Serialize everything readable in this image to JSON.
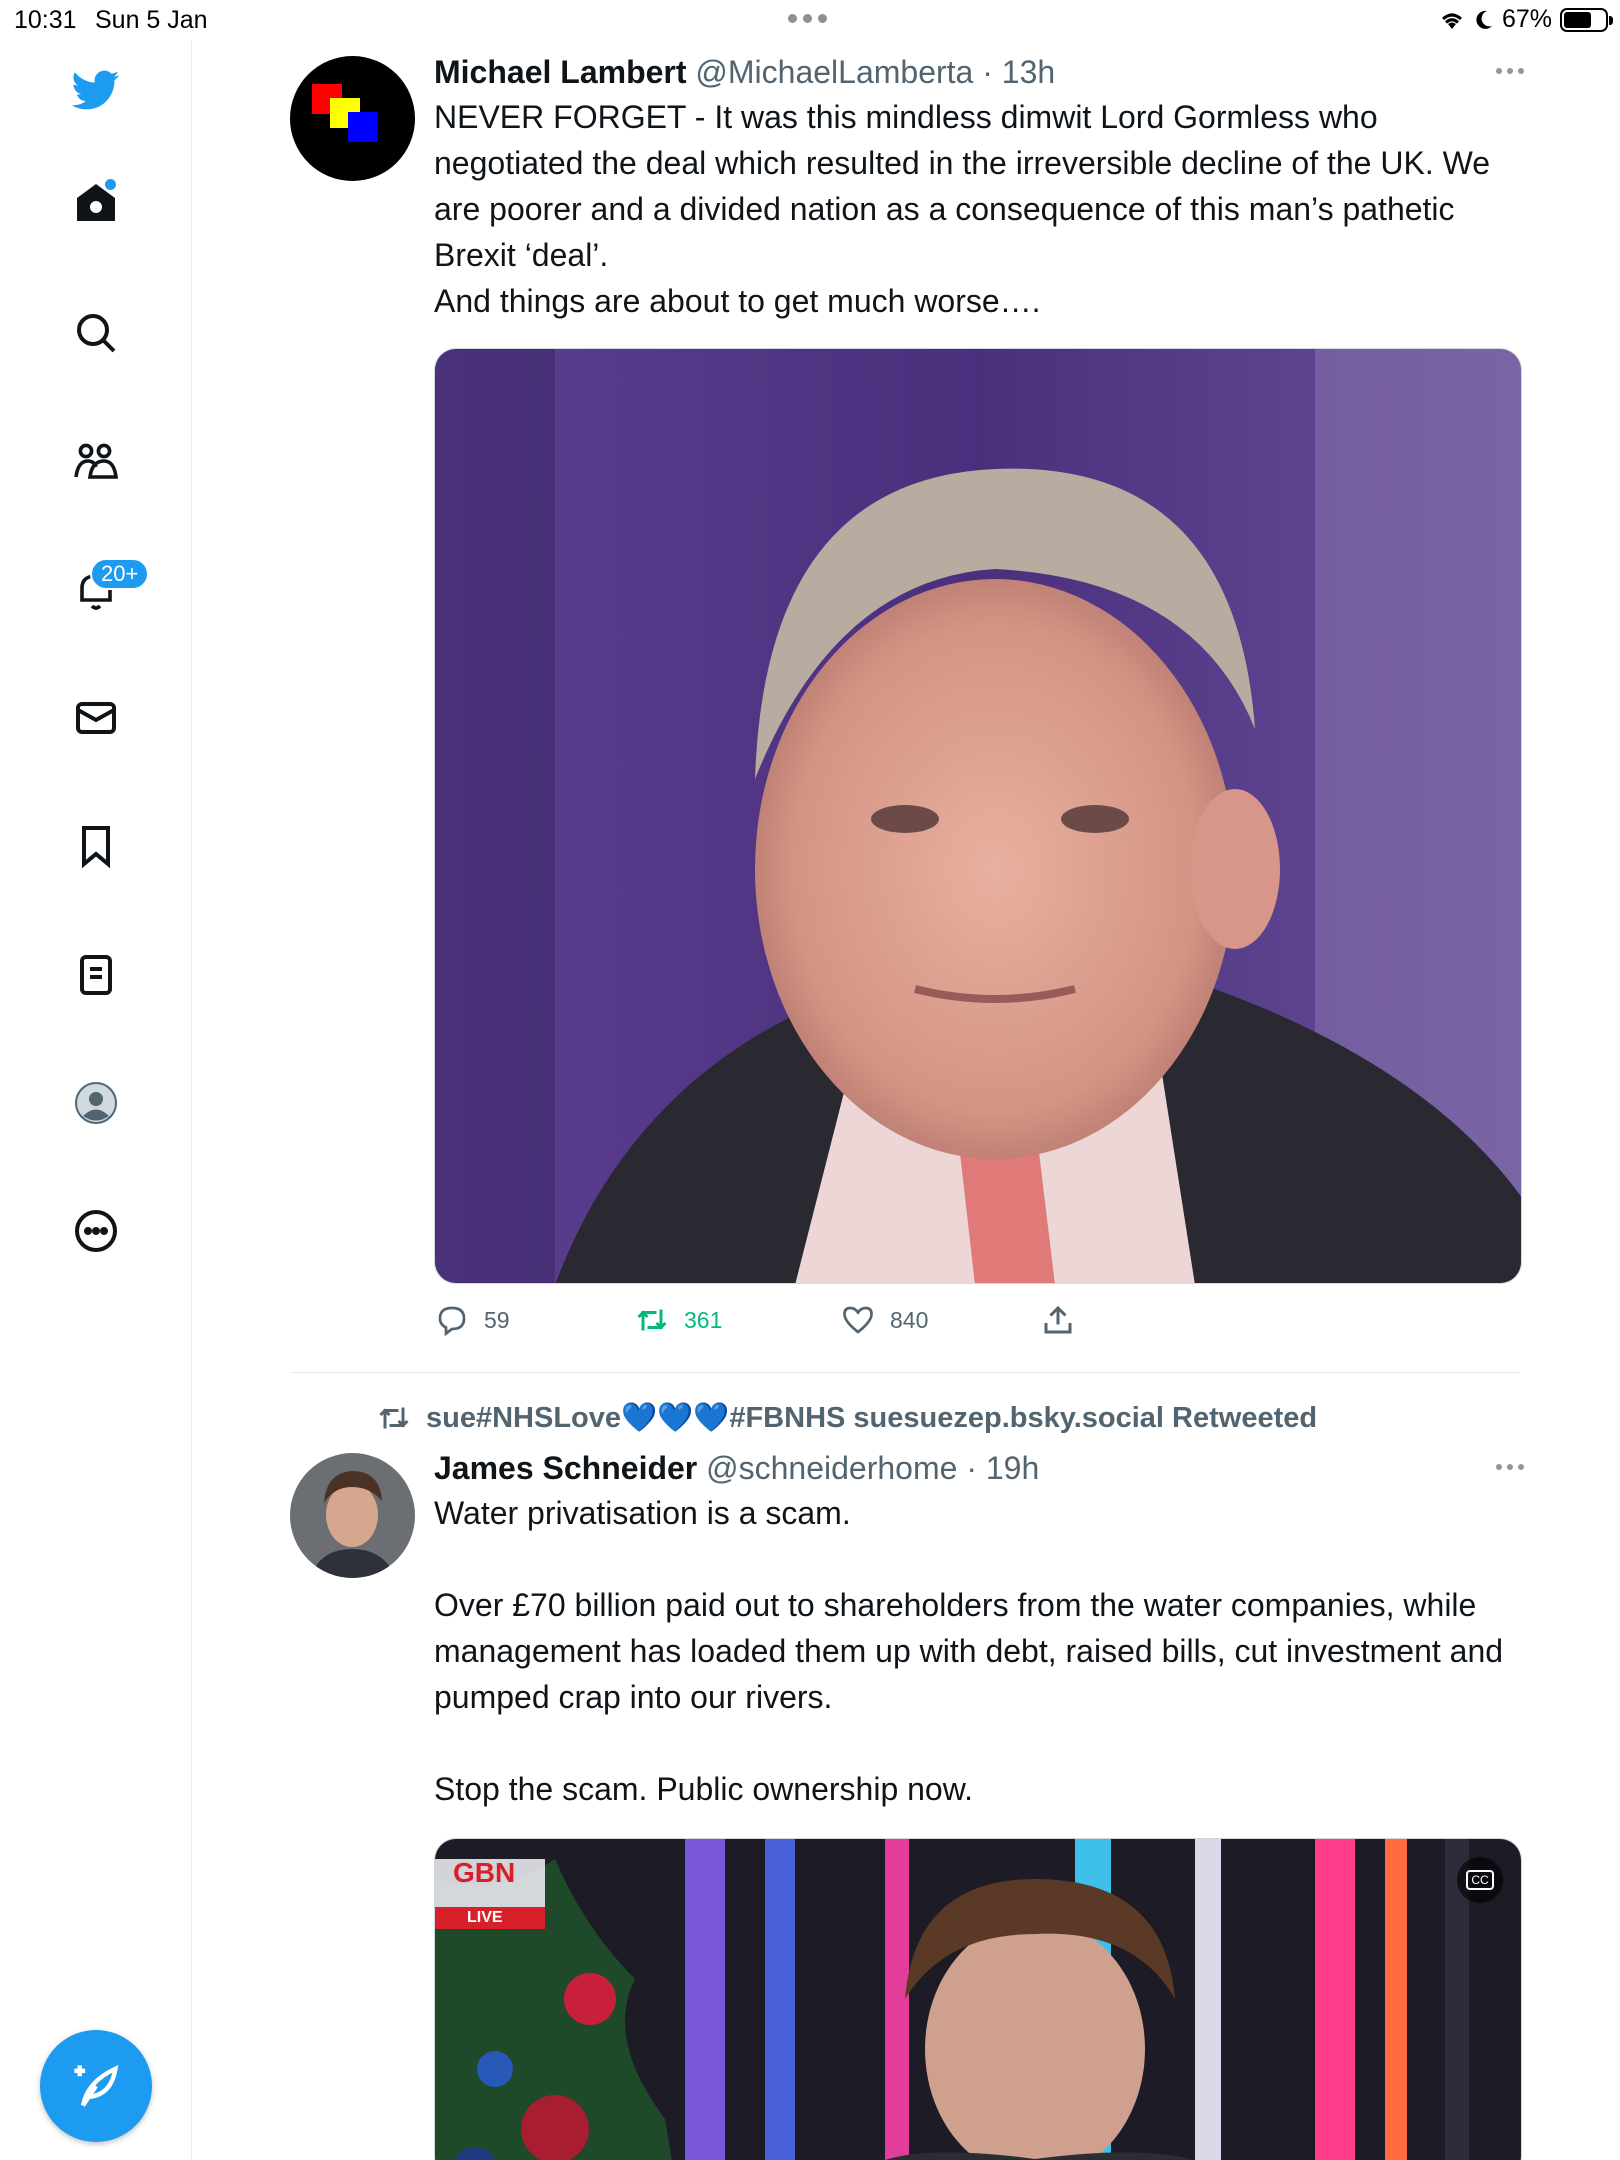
{
  "status_bar": {
    "time": "10:31",
    "date": "Sun 5 Jan",
    "battery": "67%",
    "battery_level": 0.67
  },
  "sidebar": {
    "items": [
      {
        "name": "twitter-logo"
      },
      {
        "name": "home"
      },
      {
        "name": "search"
      },
      {
        "name": "communities"
      },
      {
        "name": "notifications",
        "badge": "20+"
      },
      {
        "name": "messages"
      },
      {
        "name": "bookmarks"
      },
      {
        "name": "lists"
      },
      {
        "name": "profile"
      },
      {
        "name": "more"
      }
    ],
    "accent": "#1d9bf0"
  },
  "tweets": [
    {
      "name": "Michael Lambert",
      "handle": "@MichaelLamberta",
      "time": "· 13h",
      "text": "NEVER FORGET - It was this mindless dimwit Lord Gormless who negotiated the deal which resulted in the irreversible decline of the UK. We are poorer and a divided nation as a consequence of this man’s pathetic Brexit ‘deal’.\nAnd things are about to get much worse….",
      "replies": "59",
      "retweets": "361",
      "likes": "840"
    },
    {
      "retweeted_by": "sue#NHSLove💙💙💙#FBNHS suesuezep.bsky.social Retweeted",
      "name": "James Schneider",
      "handle": "@schneiderhome",
      "time": "· 19h",
      "text": "Water privatisation is a scam.\n\nOver £70 billion paid out to shareholders from the water companies, while management has loaded them up with debt, raised bills, cut investment and pumped crap into our rivers.\n\nStop the scam. Public ownership now.",
      "video_channel": "GBN",
      "video_live": "LIVE",
      "video_cc": "CC"
    }
  ],
  "colors": {
    "retweet_green": "#00ba7c",
    "muted": "#536471"
  }
}
